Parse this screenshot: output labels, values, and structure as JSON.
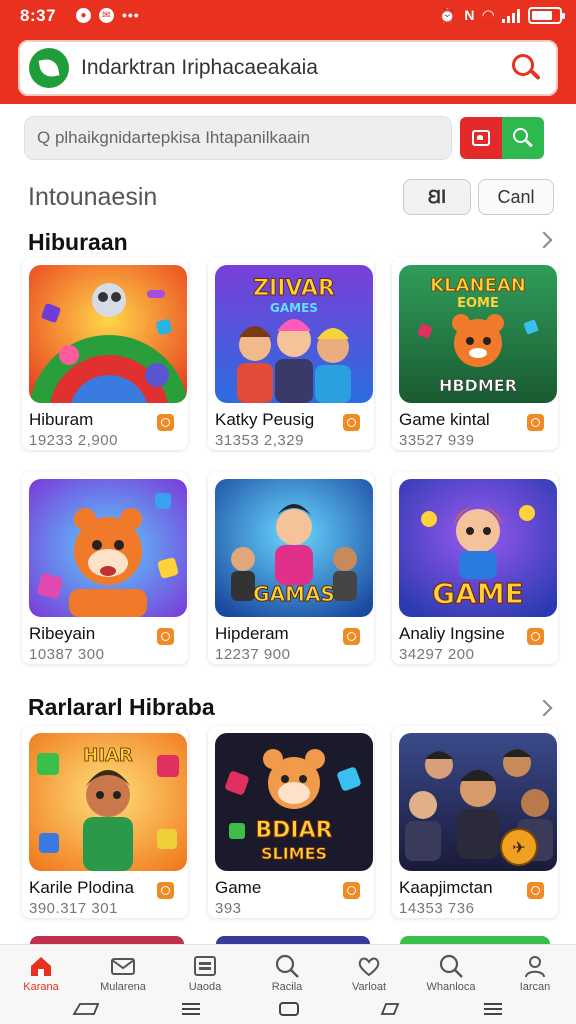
{
  "status_bar": {
    "time": "8:37",
    "dots": "•••"
  },
  "header": {
    "search_text": "Indarktran Iriphacaeakaia"
  },
  "sub_search": {
    "placeholder": "Q plhaikgnidartepkisa Ihtapanilkaain"
  },
  "category": {
    "title": "Intounaesin",
    "pill_a": "Ꞛl",
    "pill_b": "Canl"
  },
  "sections": [
    {
      "title": "Hiburaan",
      "cards": [
        {
          "name": "Hiburam",
          "count": "19233 2,900"
        },
        {
          "name": "Katky Peusig",
          "count": "31353 2,329"
        },
        {
          "name": "Game kintal",
          "count": "33527 939"
        },
        {
          "name": "Ribeyain",
          "count": "10387 300"
        },
        {
          "name": "Hipderam",
          "count": "12237 900"
        },
        {
          "name": "Analiy Ingsine",
          "count": "34297 200"
        }
      ]
    },
    {
      "title": "Rarlararl Hibraba",
      "cards": [
        {
          "name": "Karile Plodina",
          "count": "390.317 301"
        },
        {
          "name": "Game",
          "count": "393"
        },
        {
          "name": "Kaapjimctan",
          "count": "14353 736"
        }
      ]
    }
  ],
  "art_text": {
    "t2": "ZIIVAR",
    "t2b": "GAMES",
    "t3": "KLANEAN",
    "t3b": "EOME",
    "t3c": "HBDMER",
    "t5": "GAMAS",
    "t6": "GAME",
    "t7": "HIAR",
    "t8": "BDIAR",
    "t8b": "SLIMES"
  },
  "nav": [
    {
      "label": "Karana",
      "icon": "home-icon"
    },
    {
      "label": "Mularena",
      "icon": "mail-icon"
    },
    {
      "label": "Uaoda",
      "icon": "tablet-icon"
    },
    {
      "label": "Racila",
      "icon": "search-icon"
    },
    {
      "label": "Varloat",
      "icon": "heart-icon"
    },
    {
      "label": "Whanloca",
      "icon": "search-icon"
    },
    {
      "label": "Iarcan",
      "icon": "person-icon"
    }
  ],
  "colors": {
    "accent": "#e8311f",
    "green": "#2fb84e",
    "badge": "#f08a24"
  }
}
